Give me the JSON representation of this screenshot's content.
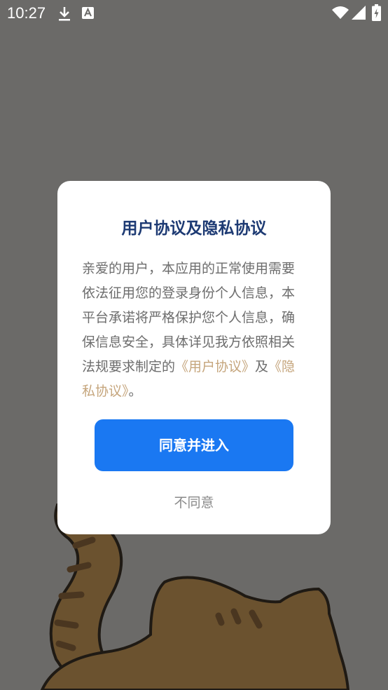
{
  "status_bar": {
    "time": "10:27",
    "icons": [
      "download-icon",
      "text-notification-icon",
      "wifi-icon",
      "signal-icon",
      "battery-charging-icon"
    ]
  },
  "dialog": {
    "title": "用户协议及隐私协议",
    "body_text": "亲爱的用户，本应用的正常使用需要依法征用您的登录身份个人信息，本平台承诺将严格保护您个人信息，确保信息安全，具体详见我方依照相关法规要求制定的",
    "user_agreement_link": "《用户协议》",
    "conjunction": "及",
    "privacy_link": "《隐私协议》",
    "ending": "。",
    "agree_button": "同意并进入",
    "disagree_button": "不同意"
  },
  "colors": {
    "overlay": "#6b6a68",
    "title": "#1d3a73",
    "link": "#c5a57c",
    "primary_button": "#1a78f2"
  }
}
